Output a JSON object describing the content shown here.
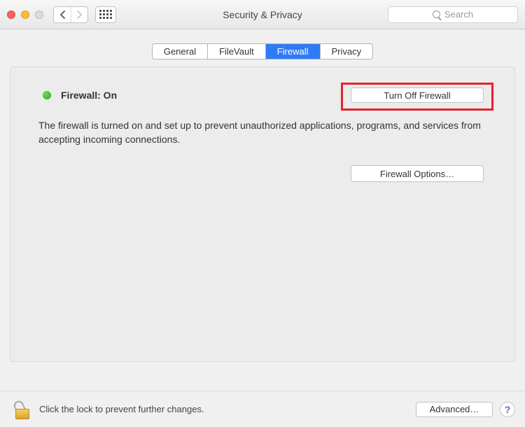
{
  "window": {
    "title": "Security & Privacy",
    "search_placeholder": "Search"
  },
  "tabs": {
    "general": "General",
    "filevault": "FileVault",
    "firewall": "Firewall",
    "privacy": "Privacy",
    "active": "firewall"
  },
  "firewall": {
    "status_label": "Firewall: On",
    "turn_off_label": "Turn Off Firewall",
    "description": "The firewall is turned on and set up to prevent unauthorized applications, programs, and services from accepting incoming connections.",
    "options_label": "Firewall Options…"
  },
  "footer": {
    "lock_text": "Click the lock to prevent further changes.",
    "advanced_label": "Advanced…",
    "help_label": "?"
  }
}
